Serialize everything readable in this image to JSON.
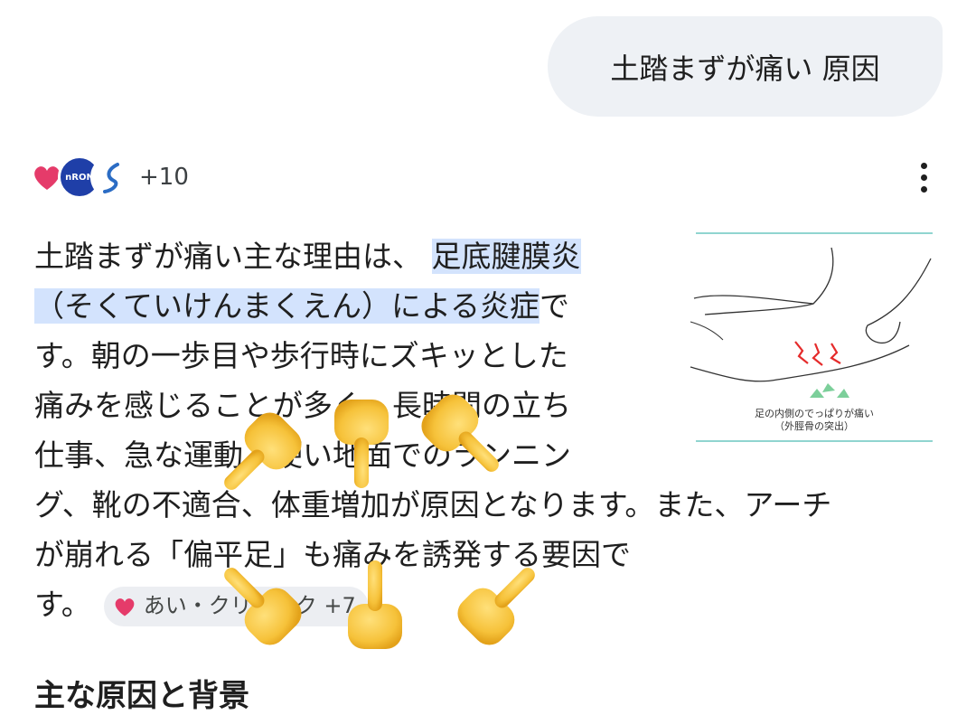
{
  "query": {
    "text": "土踏まずが痛い 原因"
  },
  "sources": {
    "count_label": "+10",
    "blue_icon_text": "nRON"
  },
  "answer": {
    "line1_pre": "土踏まずが痛い主な理由は、",
    "highlight_line1": "足底腱膜炎",
    "highlight_line2": "（そくていけんまくえん）による炎症",
    "line2_post": "で",
    "line3": "す。朝の一歩目や歩行時にズキッとした",
    "line4": "痛みを感じることが多く、長時間の立ち",
    "line5": "仕事、急な運動、硬い地面でのランニン",
    "line6": "グ、靴の不適合、体重増加が原因となります。また、アーチ",
    "line7": "が崩れる「偏平足」も痛みを誘発する要因で",
    "line8": "す。",
    "chip_label": "あい・クリニック +7"
  },
  "thumbnail": {
    "caption_line1": "足の内側のでっぱりが痛い",
    "caption_line2": "（外脛骨の突出）"
  },
  "next_heading": "主な原因と背景",
  "colors": {
    "bubble": "#eef1f5",
    "highlight": "#d3e3fd",
    "chip": "#eceef2",
    "brand_pink": "#e53b6a",
    "brand_blue": "#1f3fa8"
  },
  "icons": [
    "heart-logo-icon",
    "omron-logo-icon",
    "spine-logo-icon",
    "more-vert-icon",
    "pointing-hand-emoji-icon"
  ]
}
